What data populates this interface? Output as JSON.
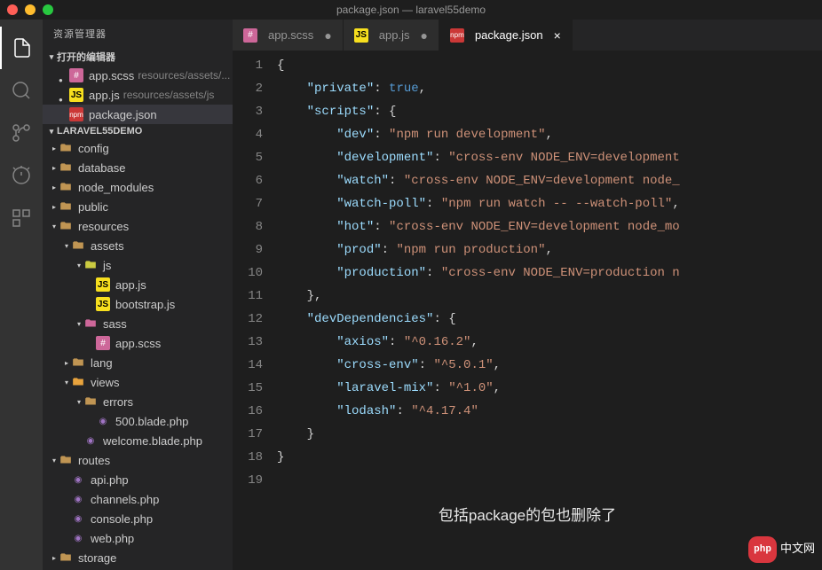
{
  "window": {
    "title": "package.json — laravel55demo"
  },
  "sidebar": {
    "title": "资源管理器",
    "open_editors_label": "打开的编辑器",
    "project_label": "LARAVEL55DEMO",
    "open_editors": [
      {
        "name": "app.scss",
        "path": "resources/assets/...",
        "modified": true,
        "icon": "scss"
      },
      {
        "name": "app.js",
        "path": "resources/assets/js",
        "modified": true,
        "icon": "js"
      },
      {
        "name": "package.json",
        "path": "",
        "modified": false,
        "icon": "npm",
        "active": true
      }
    ],
    "tree": [
      {
        "depth": 0,
        "type": "folder",
        "name": "config",
        "expanded": false
      },
      {
        "depth": 0,
        "type": "folder",
        "name": "database",
        "expanded": false
      },
      {
        "depth": 0,
        "type": "folder",
        "name": "node_modules",
        "expanded": false
      },
      {
        "depth": 0,
        "type": "folder",
        "name": "public",
        "expanded": false
      },
      {
        "depth": 0,
        "type": "folder",
        "name": "resources",
        "expanded": true
      },
      {
        "depth": 1,
        "type": "folder",
        "name": "assets",
        "expanded": true
      },
      {
        "depth": 2,
        "type": "folder",
        "name": "js",
        "expanded": true,
        "accent": "js"
      },
      {
        "depth": 3,
        "type": "file",
        "name": "app.js",
        "icon": "js"
      },
      {
        "depth": 3,
        "type": "file",
        "name": "bootstrap.js",
        "icon": "js"
      },
      {
        "depth": 2,
        "type": "folder",
        "name": "sass",
        "expanded": true,
        "accent": "sass"
      },
      {
        "depth": 3,
        "type": "file",
        "name": "app.scss",
        "icon": "scss"
      },
      {
        "depth": 1,
        "type": "folder",
        "name": "lang",
        "expanded": false
      },
      {
        "depth": 1,
        "type": "folder",
        "name": "views",
        "expanded": true,
        "accent": "views"
      },
      {
        "depth": 2,
        "type": "folder",
        "name": "errors",
        "expanded": true
      },
      {
        "depth": 3,
        "type": "file",
        "name": "500.blade.php",
        "icon": "php"
      },
      {
        "depth": 2,
        "type": "file",
        "name": "welcome.blade.php",
        "icon": "php"
      },
      {
        "depth": 0,
        "type": "folder",
        "name": "routes",
        "expanded": true
      },
      {
        "depth": 1,
        "type": "file",
        "name": "api.php",
        "icon": "php"
      },
      {
        "depth": 1,
        "type": "file",
        "name": "channels.php",
        "icon": "php"
      },
      {
        "depth": 1,
        "type": "file",
        "name": "console.php",
        "icon": "php"
      },
      {
        "depth": 1,
        "type": "file",
        "name": "web.php",
        "icon": "php"
      },
      {
        "depth": 0,
        "type": "folder",
        "name": "storage",
        "expanded": false
      }
    ]
  },
  "tabs": [
    {
      "name": "app.scss",
      "icon": "scss",
      "active": false,
      "modified": true
    },
    {
      "name": "app.js",
      "icon": "js",
      "active": false,
      "modified": true
    },
    {
      "name": "package.json",
      "icon": "npm",
      "active": true,
      "modified": false
    }
  ],
  "code": {
    "line_count": 19,
    "lines": [
      [
        {
          "t": "brace",
          "v": "{"
        }
      ],
      [
        {
          "t": "indent",
          "v": 1
        },
        {
          "t": "key",
          "v": "\"private\""
        },
        {
          "t": "colon",
          "v": ": "
        },
        {
          "t": "bool",
          "v": "true"
        },
        {
          "t": "comma",
          "v": ","
        }
      ],
      [
        {
          "t": "indent",
          "v": 1
        },
        {
          "t": "key",
          "v": "\"scripts\""
        },
        {
          "t": "colon",
          "v": ": "
        },
        {
          "t": "brace",
          "v": "{"
        }
      ],
      [
        {
          "t": "indent",
          "v": 2
        },
        {
          "t": "key",
          "v": "\"dev\""
        },
        {
          "t": "colon",
          "v": ": "
        },
        {
          "t": "string",
          "v": "\"npm run development\""
        },
        {
          "t": "comma",
          "v": ","
        }
      ],
      [
        {
          "t": "indent",
          "v": 2
        },
        {
          "t": "key",
          "v": "\"development\""
        },
        {
          "t": "colon",
          "v": ": "
        },
        {
          "t": "string",
          "v": "\"cross-env NODE_ENV=development"
        }
      ],
      [
        {
          "t": "indent",
          "v": 2
        },
        {
          "t": "key",
          "v": "\"watch\""
        },
        {
          "t": "colon",
          "v": ": "
        },
        {
          "t": "string",
          "v": "\"cross-env NODE_ENV=development node_"
        }
      ],
      [
        {
          "t": "indent",
          "v": 2
        },
        {
          "t": "key",
          "v": "\"watch-poll\""
        },
        {
          "t": "colon",
          "v": ": "
        },
        {
          "t": "string",
          "v": "\"npm run watch -- --watch-poll\""
        },
        {
          "t": "comma",
          "v": ","
        }
      ],
      [
        {
          "t": "indent",
          "v": 2
        },
        {
          "t": "key",
          "v": "\"hot\""
        },
        {
          "t": "colon",
          "v": ": "
        },
        {
          "t": "string",
          "v": "\"cross-env NODE_ENV=development node_mo"
        }
      ],
      [
        {
          "t": "indent",
          "v": 2
        },
        {
          "t": "key",
          "v": "\"prod\""
        },
        {
          "t": "colon",
          "v": ": "
        },
        {
          "t": "string",
          "v": "\"npm run production\""
        },
        {
          "t": "comma",
          "v": ","
        }
      ],
      [
        {
          "t": "indent",
          "v": 2
        },
        {
          "t": "key",
          "v": "\"production\""
        },
        {
          "t": "colon",
          "v": ": "
        },
        {
          "t": "string",
          "v": "\"cross-env NODE_ENV=production n"
        }
      ],
      [
        {
          "t": "indent",
          "v": 1
        },
        {
          "t": "brace",
          "v": "}"
        },
        {
          "t": "comma",
          "v": ","
        }
      ],
      [
        {
          "t": "indent",
          "v": 1
        },
        {
          "t": "key",
          "v": "\"devDependencies\""
        },
        {
          "t": "colon",
          "v": ": "
        },
        {
          "t": "brace",
          "v": "{"
        }
      ],
      [
        {
          "t": "indent",
          "v": 2
        },
        {
          "t": "key",
          "v": "\"axios\""
        },
        {
          "t": "colon",
          "v": ": "
        },
        {
          "t": "string",
          "v": "\"^0.16.2\""
        },
        {
          "t": "comma",
          "v": ","
        }
      ],
      [
        {
          "t": "indent",
          "v": 2
        },
        {
          "t": "key",
          "v": "\"cross-env\""
        },
        {
          "t": "colon",
          "v": ": "
        },
        {
          "t": "string",
          "v": "\"^5.0.1\""
        },
        {
          "t": "comma",
          "v": ","
        }
      ],
      [
        {
          "t": "indent",
          "v": 2
        },
        {
          "t": "key",
          "v": "\"laravel-mix\""
        },
        {
          "t": "colon",
          "v": ": "
        },
        {
          "t": "string",
          "v": "\"^1.0\""
        },
        {
          "t": "comma",
          "v": ","
        }
      ],
      [
        {
          "t": "indent",
          "v": 2
        },
        {
          "t": "key",
          "v": "\"lodash\""
        },
        {
          "t": "colon",
          "v": ": "
        },
        {
          "t": "string",
          "v": "\"^4.17.4\""
        }
      ],
      [
        {
          "t": "indent",
          "v": 1
        },
        {
          "t": "brace",
          "v": "}"
        }
      ],
      [
        {
          "t": "brace",
          "v": "}"
        }
      ],
      []
    ]
  },
  "annotation": "包括package的包也删除了",
  "watermark": {
    "badge": "php",
    "text": "中文网"
  }
}
